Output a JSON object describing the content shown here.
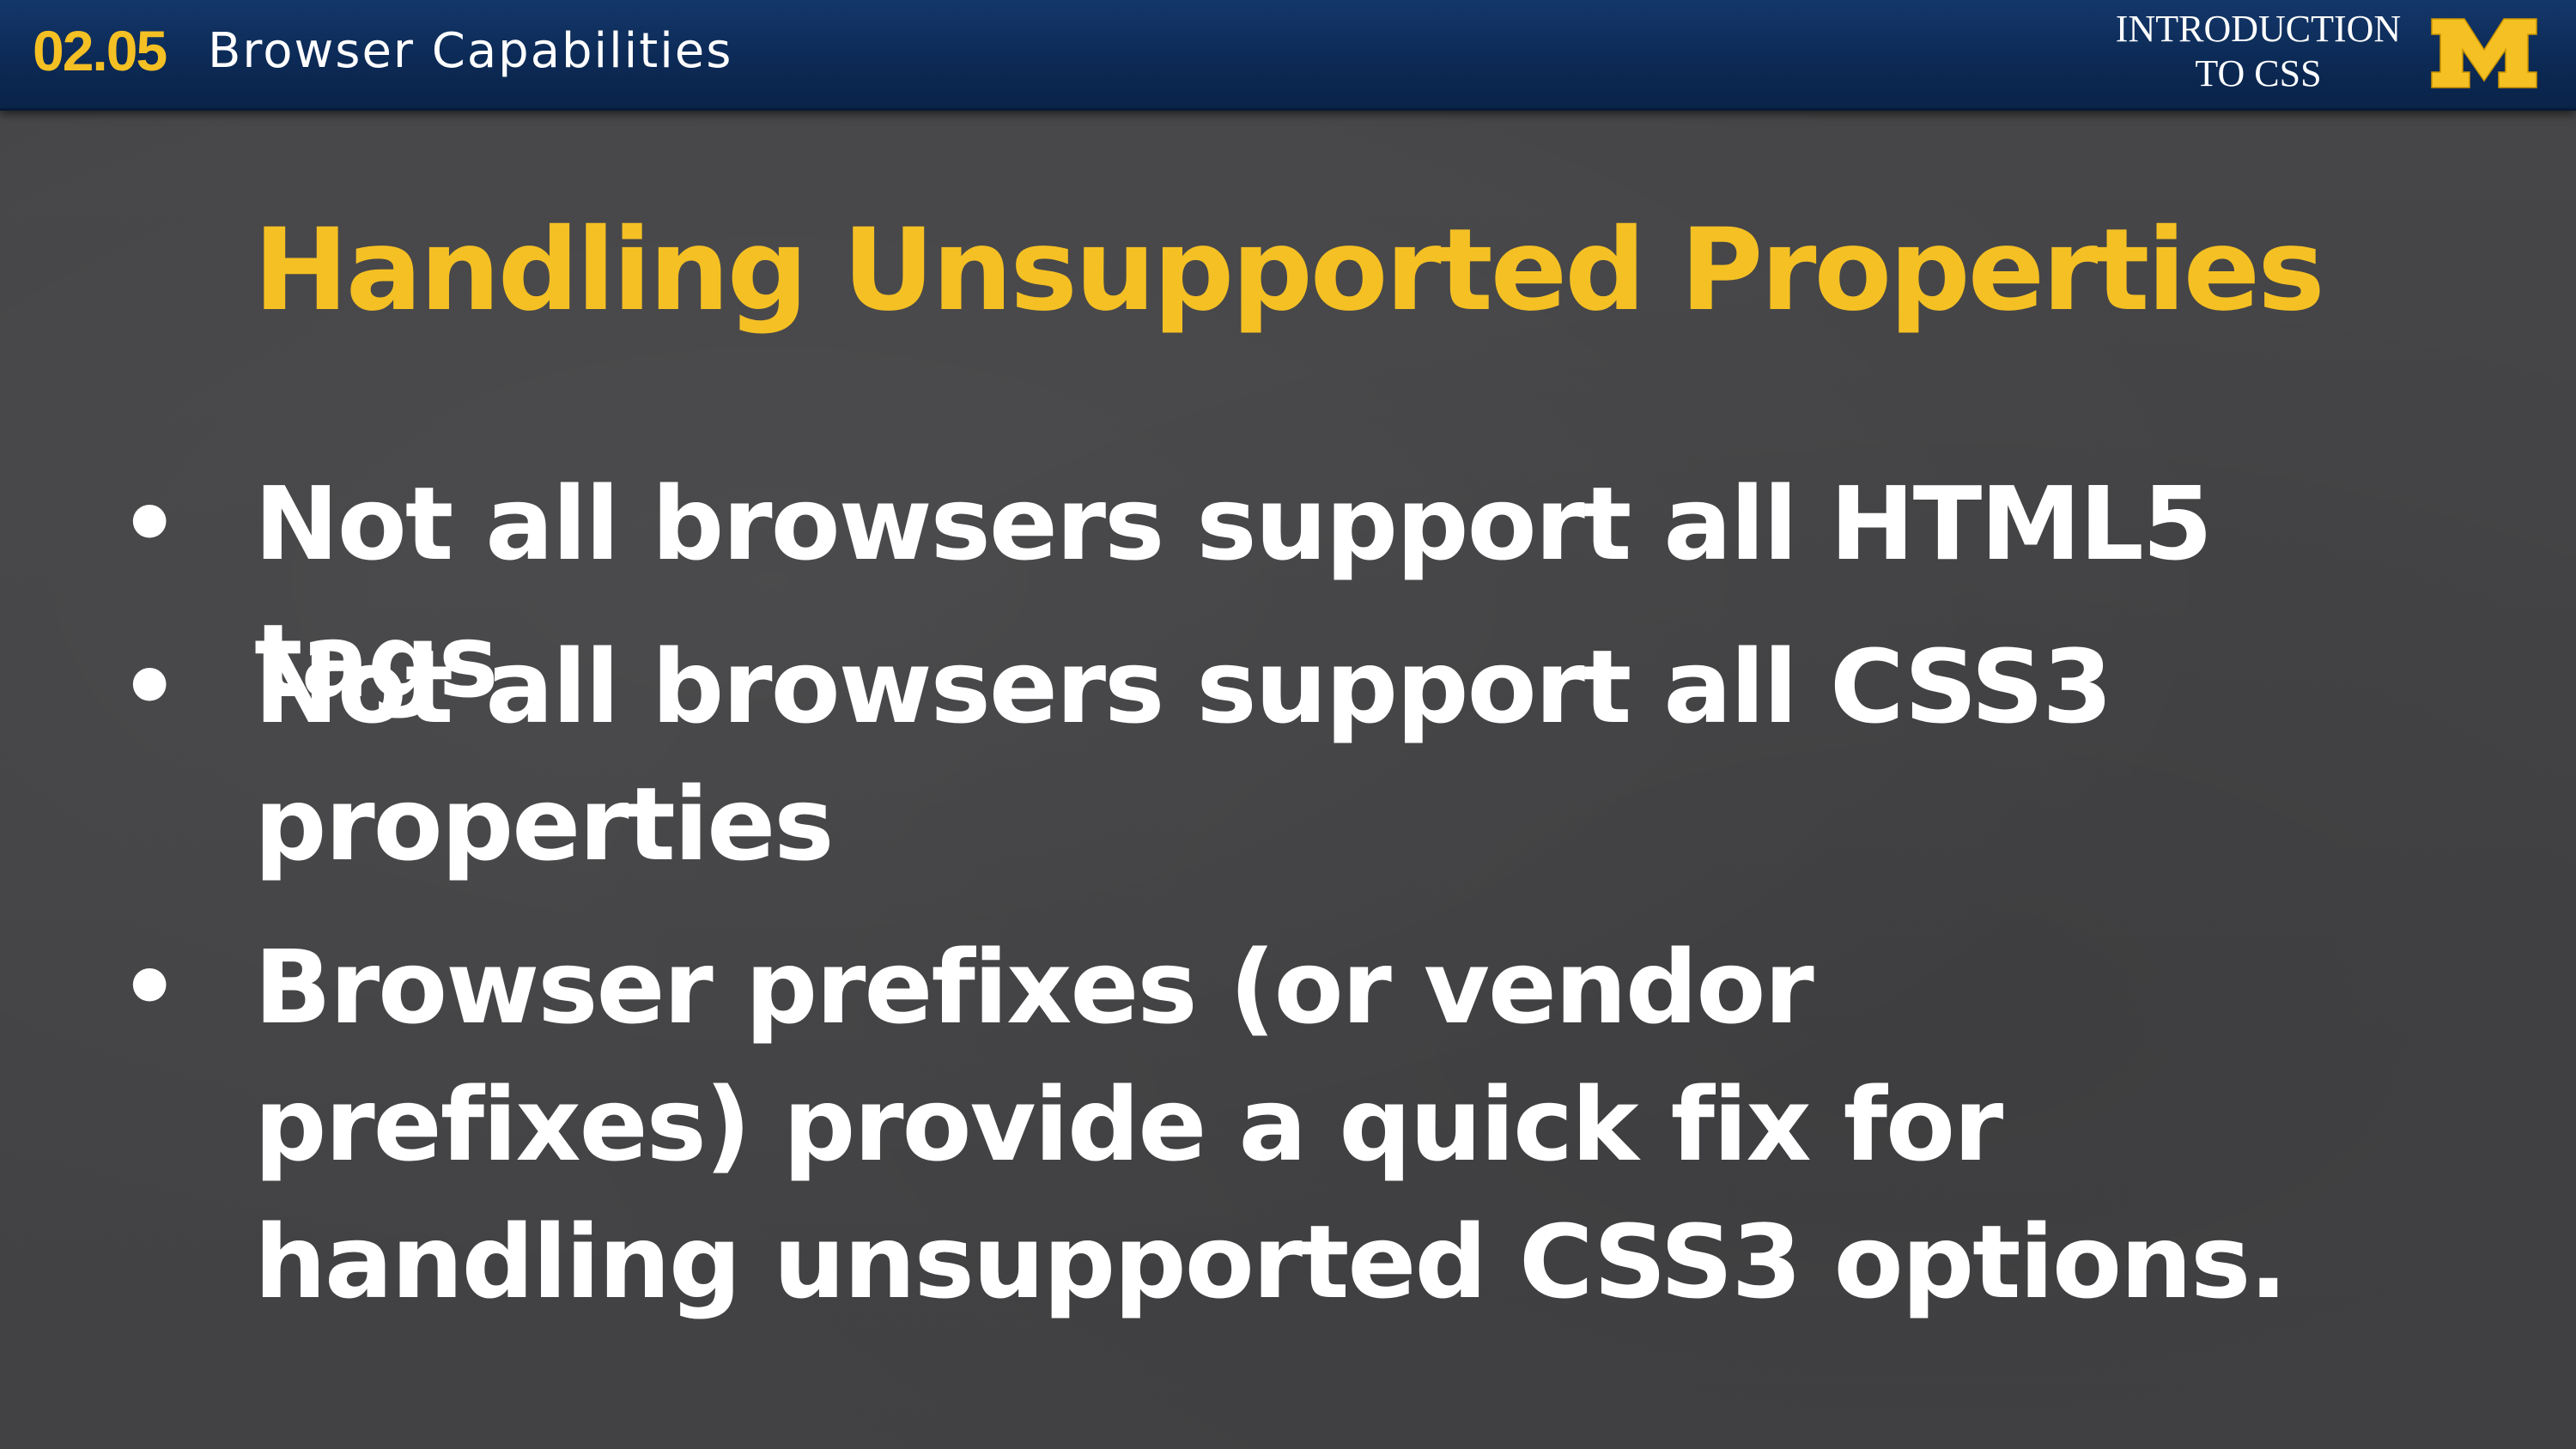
{
  "header": {
    "lesson_number": "02.05",
    "lesson_title": "Browser Capabilities",
    "course_line1": "INTRODUCTION",
    "course_line2": "TO CSS",
    "logo_icon": "block-m-logo-icon"
  },
  "slide": {
    "title": "Handling Unsupported Properties",
    "bullet_symbol": "•",
    "bullets": [
      {
        "text": "Not all browsers support all HTML5 tags"
      },
      {
        "text": "Not all browsers support all CSS3 properties"
      },
      {
        "text": "Browser prefixes (or vendor prefixes) provide a quick fix for handling unsupported CSS3 options."
      }
    ]
  },
  "colors": {
    "header_bg": "#0c2a56",
    "accent_maize": "#f5c023",
    "slide_bg": "#444446",
    "text": "#ffffff"
  }
}
